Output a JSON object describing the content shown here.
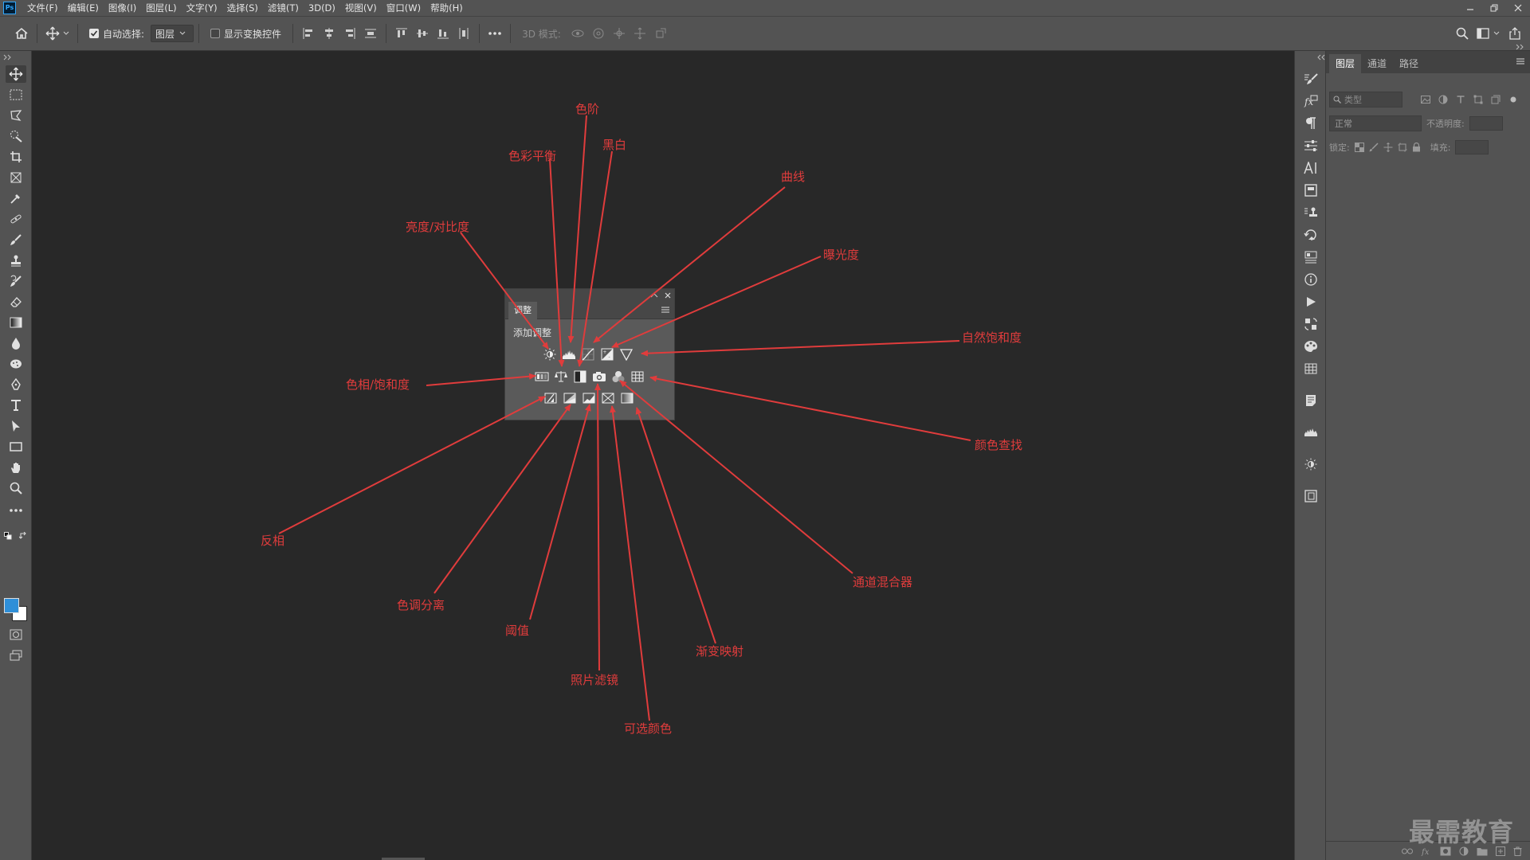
{
  "app": {
    "logo_text": "Ps"
  },
  "menubar": {
    "items": [
      "文件(F)",
      "编辑(E)",
      "图像(I)",
      "图层(L)",
      "文字(Y)",
      "选择(S)",
      "滤镜(T)",
      "3D(D)",
      "视图(V)",
      "窗口(W)",
      "帮助(H)"
    ]
  },
  "optionsbar": {
    "auto_select_label": "自动选择:",
    "auto_select_checked": true,
    "layer_select_value": "图层",
    "show_transform_label": "显示变换控件",
    "show_transform_checked": false,
    "mode_3d_label": "3D 模式:"
  },
  "adjustments_panel": {
    "tab_label": "调整",
    "title": "添加调整",
    "icons_row1": [
      "brightness-contrast-icon",
      "levels-icon",
      "curves-icon",
      "exposure-icon",
      "vibrance-icon"
    ],
    "icons_row2": [
      "hue-saturation-icon",
      "color-balance-icon",
      "black-white-icon",
      "photo-filter-icon",
      "channel-mixer-icon",
      "color-lookup-icon"
    ],
    "icons_row3": [
      "invert-icon",
      "posterize-icon",
      "threshold-icon",
      "gradient-map-icon",
      "selective-color-icon"
    ]
  },
  "annotations": {
    "levels": "色阶",
    "color_balance": "色彩平衡",
    "black_white": "黑白",
    "curves": "曲线",
    "brightness_contrast": "亮度/对比度",
    "exposure": "曝光度",
    "vibrance": "自然饱和度",
    "hue_saturation": "色相/饱和度",
    "color_lookup": "颜色查找",
    "invert": "反相",
    "channel_mixer": "通道混合器",
    "posterize": "色调分离",
    "threshold": "阈值",
    "gradient_map": "渐变映射",
    "photo_filter": "照片滤镜",
    "selective_color": "可选颜色"
  },
  "layers_panel": {
    "tabs": [
      "图层",
      "通道",
      "路径"
    ],
    "active_tab": "图层",
    "filter_placeholder": "类型",
    "blend_mode": "正常",
    "opacity_label": "不透明度:",
    "lock_label": "锁定:",
    "fill_label": "填充:"
  },
  "watermark": "最需教育",
  "colors": {
    "annotation": "#e03c3c",
    "foreground": "#2f8fd8",
    "background_swatch": "#ffffff"
  }
}
